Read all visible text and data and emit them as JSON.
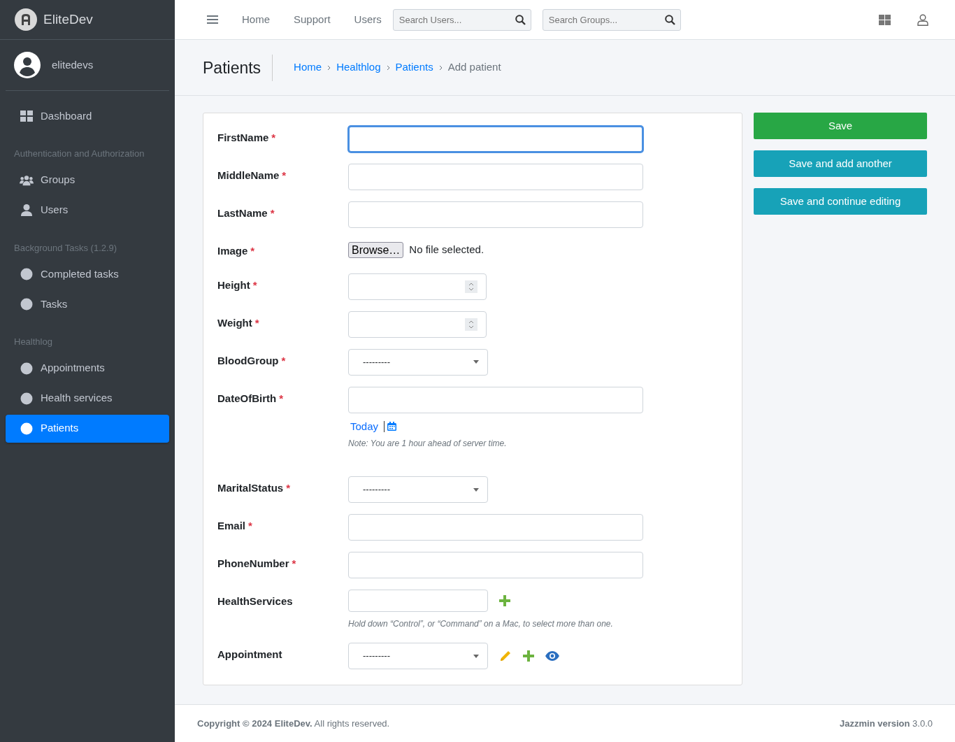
{
  "brand": {
    "name": "EliteDev"
  },
  "user": {
    "name": "elitedevs"
  },
  "sidebar": [
    {
      "items": [
        {
          "label": "Dashboard",
          "kind": "dashboard",
          "selected": false
        }
      ]
    },
    {
      "header": "Authentication and Authorization",
      "items": [
        {
          "label": "Groups",
          "kind": "group",
          "selected": false
        },
        {
          "label": "Users",
          "kind": "person",
          "selected": false
        }
      ]
    },
    {
      "header": "Background Tasks (1.2.9)",
      "items": [
        {
          "label": "Completed tasks",
          "kind": "dot",
          "selected": false
        },
        {
          "label": "Tasks",
          "kind": "dot",
          "selected": false
        }
      ]
    },
    {
      "header": "Healthlog",
      "items": [
        {
          "label": "Appointments",
          "kind": "dot",
          "selected": false
        },
        {
          "label": "Health services",
          "kind": "dot",
          "selected": false
        },
        {
          "label": "Patients",
          "kind": "dot",
          "selected": true
        }
      ]
    }
  ],
  "topnav": {
    "links": [
      "Home",
      "Support",
      "Users"
    ],
    "searches": [
      {
        "placeholder": "Search Users..."
      },
      {
        "placeholder": "Search Groups..."
      }
    ]
  },
  "header": {
    "title": "Patients",
    "breadcrumbs": [
      {
        "label": "Home",
        "link": true
      },
      {
        "label": "Healthlog",
        "link": true
      },
      {
        "label": "Patients",
        "link": true
      },
      {
        "label": "Add patient",
        "link": false
      }
    ]
  },
  "fields": [
    {
      "label": "FirstName",
      "required_mark": "*",
      "kind": "text",
      "focused": true
    },
    {
      "label": "MiddleName",
      "required_mark": "*",
      "kind": "text",
      "focused": false
    },
    {
      "label": "LastName",
      "required_mark": "*",
      "kind": "text",
      "focused": false
    },
    {
      "label": "Image",
      "required_mark": "*",
      "kind": "file",
      "button": "Browse…",
      "status": "No file selected."
    },
    {
      "label": "Height",
      "required_mark": "*",
      "kind": "number",
      "focused": false
    },
    {
      "label": "Weight",
      "required_mark": "*",
      "kind": "number",
      "focused": false
    },
    {
      "label": "BloodGroup",
      "required_mark": "*",
      "kind": "select",
      "value": "---------"
    },
    {
      "label": "DateOfBirth",
      "required_mark": "*",
      "kind": "date",
      "focused": false,
      "shortcut": "Today",
      "note": "Note: You are 1 hour ahead of server time."
    },
    {
      "label": "MaritalStatus",
      "required_mark": "*",
      "kind": "select",
      "value": "---------"
    },
    {
      "label": "Email",
      "required_mark": "*",
      "kind": "text",
      "focused": false
    },
    {
      "label": "PhoneNumber",
      "required_mark": "*",
      "kind": "text",
      "focused": false
    },
    {
      "label": "HealthServices",
      "kind": "multiselect",
      "help": "Hold down “Control”, or “Command” on a Mac, to select more than one.",
      "actions": [
        {
          "kind": "add"
        }
      ]
    },
    {
      "label": "Appointment",
      "kind": "select",
      "value": "---------",
      "actions": [
        {
          "kind": "edit"
        },
        {
          "kind": "add"
        },
        {
          "kind": "view"
        }
      ]
    }
  ],
  "actions": [
    {
      "label": "Save",
      "kind": "success"
    },
    {
      "label": "Save and add another",
      "kind": "info"
    },
    {
      "label": "Save and continue editing",
      "kind": "info"
    }
  ],
  "footer": {
    "copyright": "**Copyright © 2024 EliteDev.** All rights reserved.",
    "version": "**Jazzmin version** 3.0.0"
  }
}
